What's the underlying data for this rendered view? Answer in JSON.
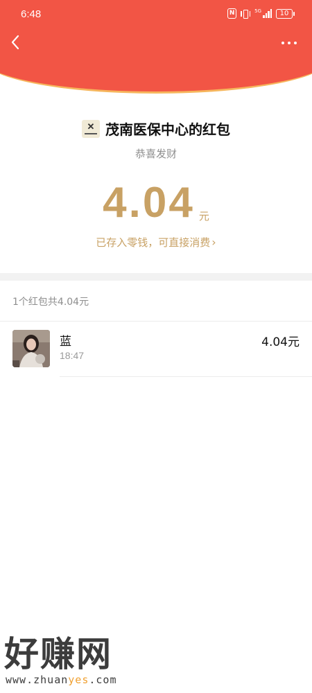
{
  "status_bar": {
    "time": "6:48",
    "nfc": "N",
    "signal_tag": "5G",
    "battery": "10"
  },
  "nav": {
    "back_icon": "chevron-left-icon",
    "more_icon": "ellipsis-icon"
  },
  "packet": {
    "sender_name": "茂南医保中心的红包",
    "greeting": "恭喜发财",
    "amount": "4.04",
    "unit": "元",
    "deposit_text": "已存入零钱，可直接消费",
    "deposit_chevron": "›"
  },
  "summary": {
    "text": "1个红包共4.04元"
  },
  "receivers": [
    {
      "name": "蓝",
      "time": "18:47",
      "amount": "4.04元"
    }
  ],
  "watermark": {
    "title": "好赚网",
    "url_prefix": "www.zhuan",
    "url_highlight": "yes",
    "url_suffix": ".com"
  },
  "colors": {
    "header_red": "#f25545",
    "gold": "#c8a164",
    "header_rim": "#f6b65d"
  }
}
